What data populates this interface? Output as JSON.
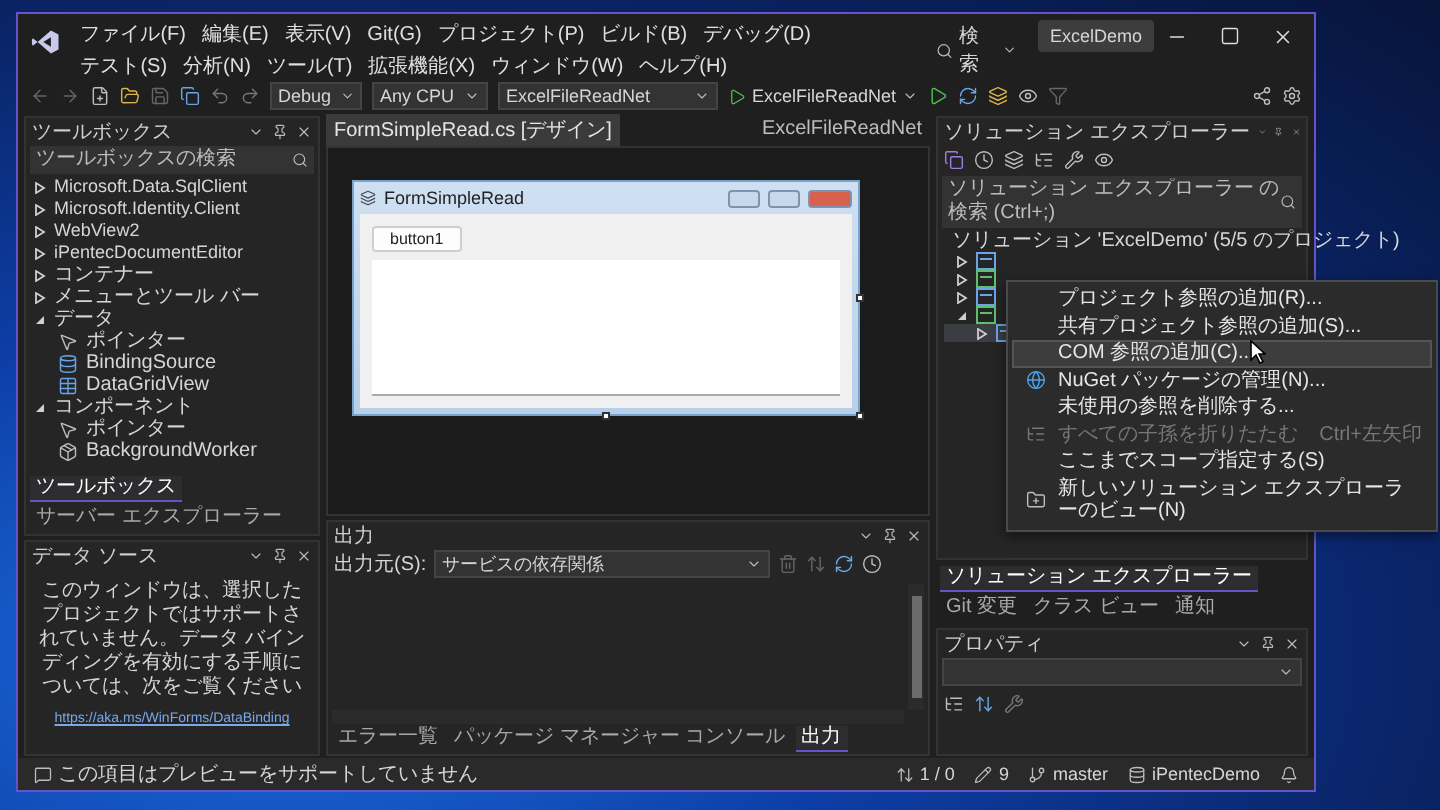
{
  "menu": [
    "ファイル(F)",
    "編集(E)",
    "表示(V)",
    "Git(G)",
    "プロジェクト(P)",
    "ビルド(B)",
    "デバッグ(D)",
    "テスト(S)",
    "分析(N)",
    "ツール(T)",
    "拡張機能(X)",
    "ウィンドウ(W)",
    "ヘルプ(H)"
  ],
  "search": {
    "label": "検索"
  },
  "solution_name": "ExcelDemo",
  "toolbar": {
    "configuration": "Debug",
    "platform": "Any CPU",
    "startup_project": "ExcelFileReadNet",
    "run_target": "ExcelFileReadNet"
  },
  "toolbox": {
    "title": "ツールボックス",
    "placeholder": "ツールボックスの検索",
    "items": [
      {
        "label": "Microsoft.Data.SqlClient",
        "expanded": false
      },
      {
        "label": "Microsoft.Identity.Client",
        "expanded": false
      },
      {
        "label": "WebView2",
        "expanded": false
      },
      {
        "label": "iPentecDocumentEditor",
        "expanded": false
      },
      {
        "label": "コンテナー",
        "expanded": false
      },
      {
        "label": "メニューとツール バー",
        "expanded": false
      },
      {
        "label": "データ",
        "expanded": true,
        "children": [
          {
            "label": "ポインター",
            "kind": "pointer"
          },
          {
            "label": "BindingSource",
            "kind": "binding"
          },
          {
            "label": "DataGridView",
            "kind": "grid"
          }
        ]
      },
      {
        "label": "コンポーネント",
        "expanded": true,
        "children": [
          {
            "label": "ポインター",
            "kind": "pointer"
          },
          {
            "label": "BackgroundWorker",
            "kind": "component"
          }
        ]
      }
    ],
    "tabs": [
      {
        "label": "ツールボックス",
        "selected": true
      },
      {
        "label": "サーバー エクスプローラー",
        "selected": false
      }
    ]
  },
  "data_sources": {
    "title": "データ ソース",
    "message": "このウィンドウは、選択したプロジェクトではサポートされていません。データ バインディングを有効にする手順については、次をご覧ください",
    "link": "https://aka.ms/WinForms/DataBinding"
  },
  "editor": {
    "tabs": [
      {
        "label": "FormSimpleRead.cs [デザイン]",
        "selected": true
      },
      {
        "label": "ExcelFileReadNet",
        "selected": false
      }
    ]
  },
  "form": {
    "title": "FormSimpleRead",
    "button": "button1"
  },
  "output": {
    "title": "出力",
    "source_label": "出力元(S):",
    "source": "サービスの依存関係",
    "tabs": [
      {
        "label": "エラー一覧",
        "selected": false
      },
      {
        "label": "パッケージ マネージャー コンソール",
        "selected": false
      },
      {
        "label": "出力",
        "selected": true
      }
    ]
  },
  "solution_explorer": {
    "title": "ソリューション エクスプローラー",
    "placeholder": "ソリューション エクスプローラー の検索 (Ctrl+;)",
    "root": "ソリューション 'ExcelDemo' (5/5 のプロジェクト)",
    "projects": [
      {
        "expanded": false,
        "selected": false
      },
      {
        "expanded": false,
        "selected": false
      },
      {
        "expanded": false,
        "selected": false
      },
      {
        "expanded": true,
        "selected": false,
        "children": [
          {
            "expanded": false,
            "selected": true
          }
        ]
      }
    ],
    "tabs": [
      {
        "label": "ソリューション エクスプローラー",
        "selected": true
      },
      {
        "label": "Git 変更",
        "selected": false
      },
      {
        "label": "クラス ビュー",
        "selected": false
      },
      {
        "label": "通知",
        "selected": false
      }
    ]
  },
  "context_menu": [
    {
      "label": "プロジェクト参照の追加(R)...",
      "kind": "plain",
      "disabled": false,
      "selected": false
    },
    {
      "label": "共有プロジェクト参照の追加(S)...",
      "kind": "plain",
      "disabled": false,
      "selected": false
    },
    {
      "label": "COM 参照の追加(C)...",
      "kind": "plain",
      "disabled": false,
      "selected": true
    },
    {
      "label": "NuGet パッケージの管理(N)...",
      "kind": "nuget",
      "disabled": false,
      "selected": false
    },
    {
      "label": "未使用の参照を削除する...",
      "kind": "plain",
      "disabled": false,
      "selected": false
    },
    {
      "label": "すべての子孫を折りたたむ",
      "kind": "collapse",
      "disabled": true,
      "selected": false,
      "shortcut": "Ctrl+左矢印"
    },
    {
      "label": "ここまでスコープ指定する(S)",
      "kind": "plain",
      "disabled": false,
      "selected": false
    },
    {
      "label": "新しいソリューション エクスプローラーのビュー(N)",
      "kind": "new-view",
      "disabled": false,
      "selected": false
    }
  ],
  "properties": {
    "title": "プロパティ"
  },
  "status_bar": {
    "message": "この項目はプレビューをサポートしていません",
    "lines": "1 / 0",
    "edits": "9",
    "branch": "master",
    "repository": "iPentecDemo"
  }
}
